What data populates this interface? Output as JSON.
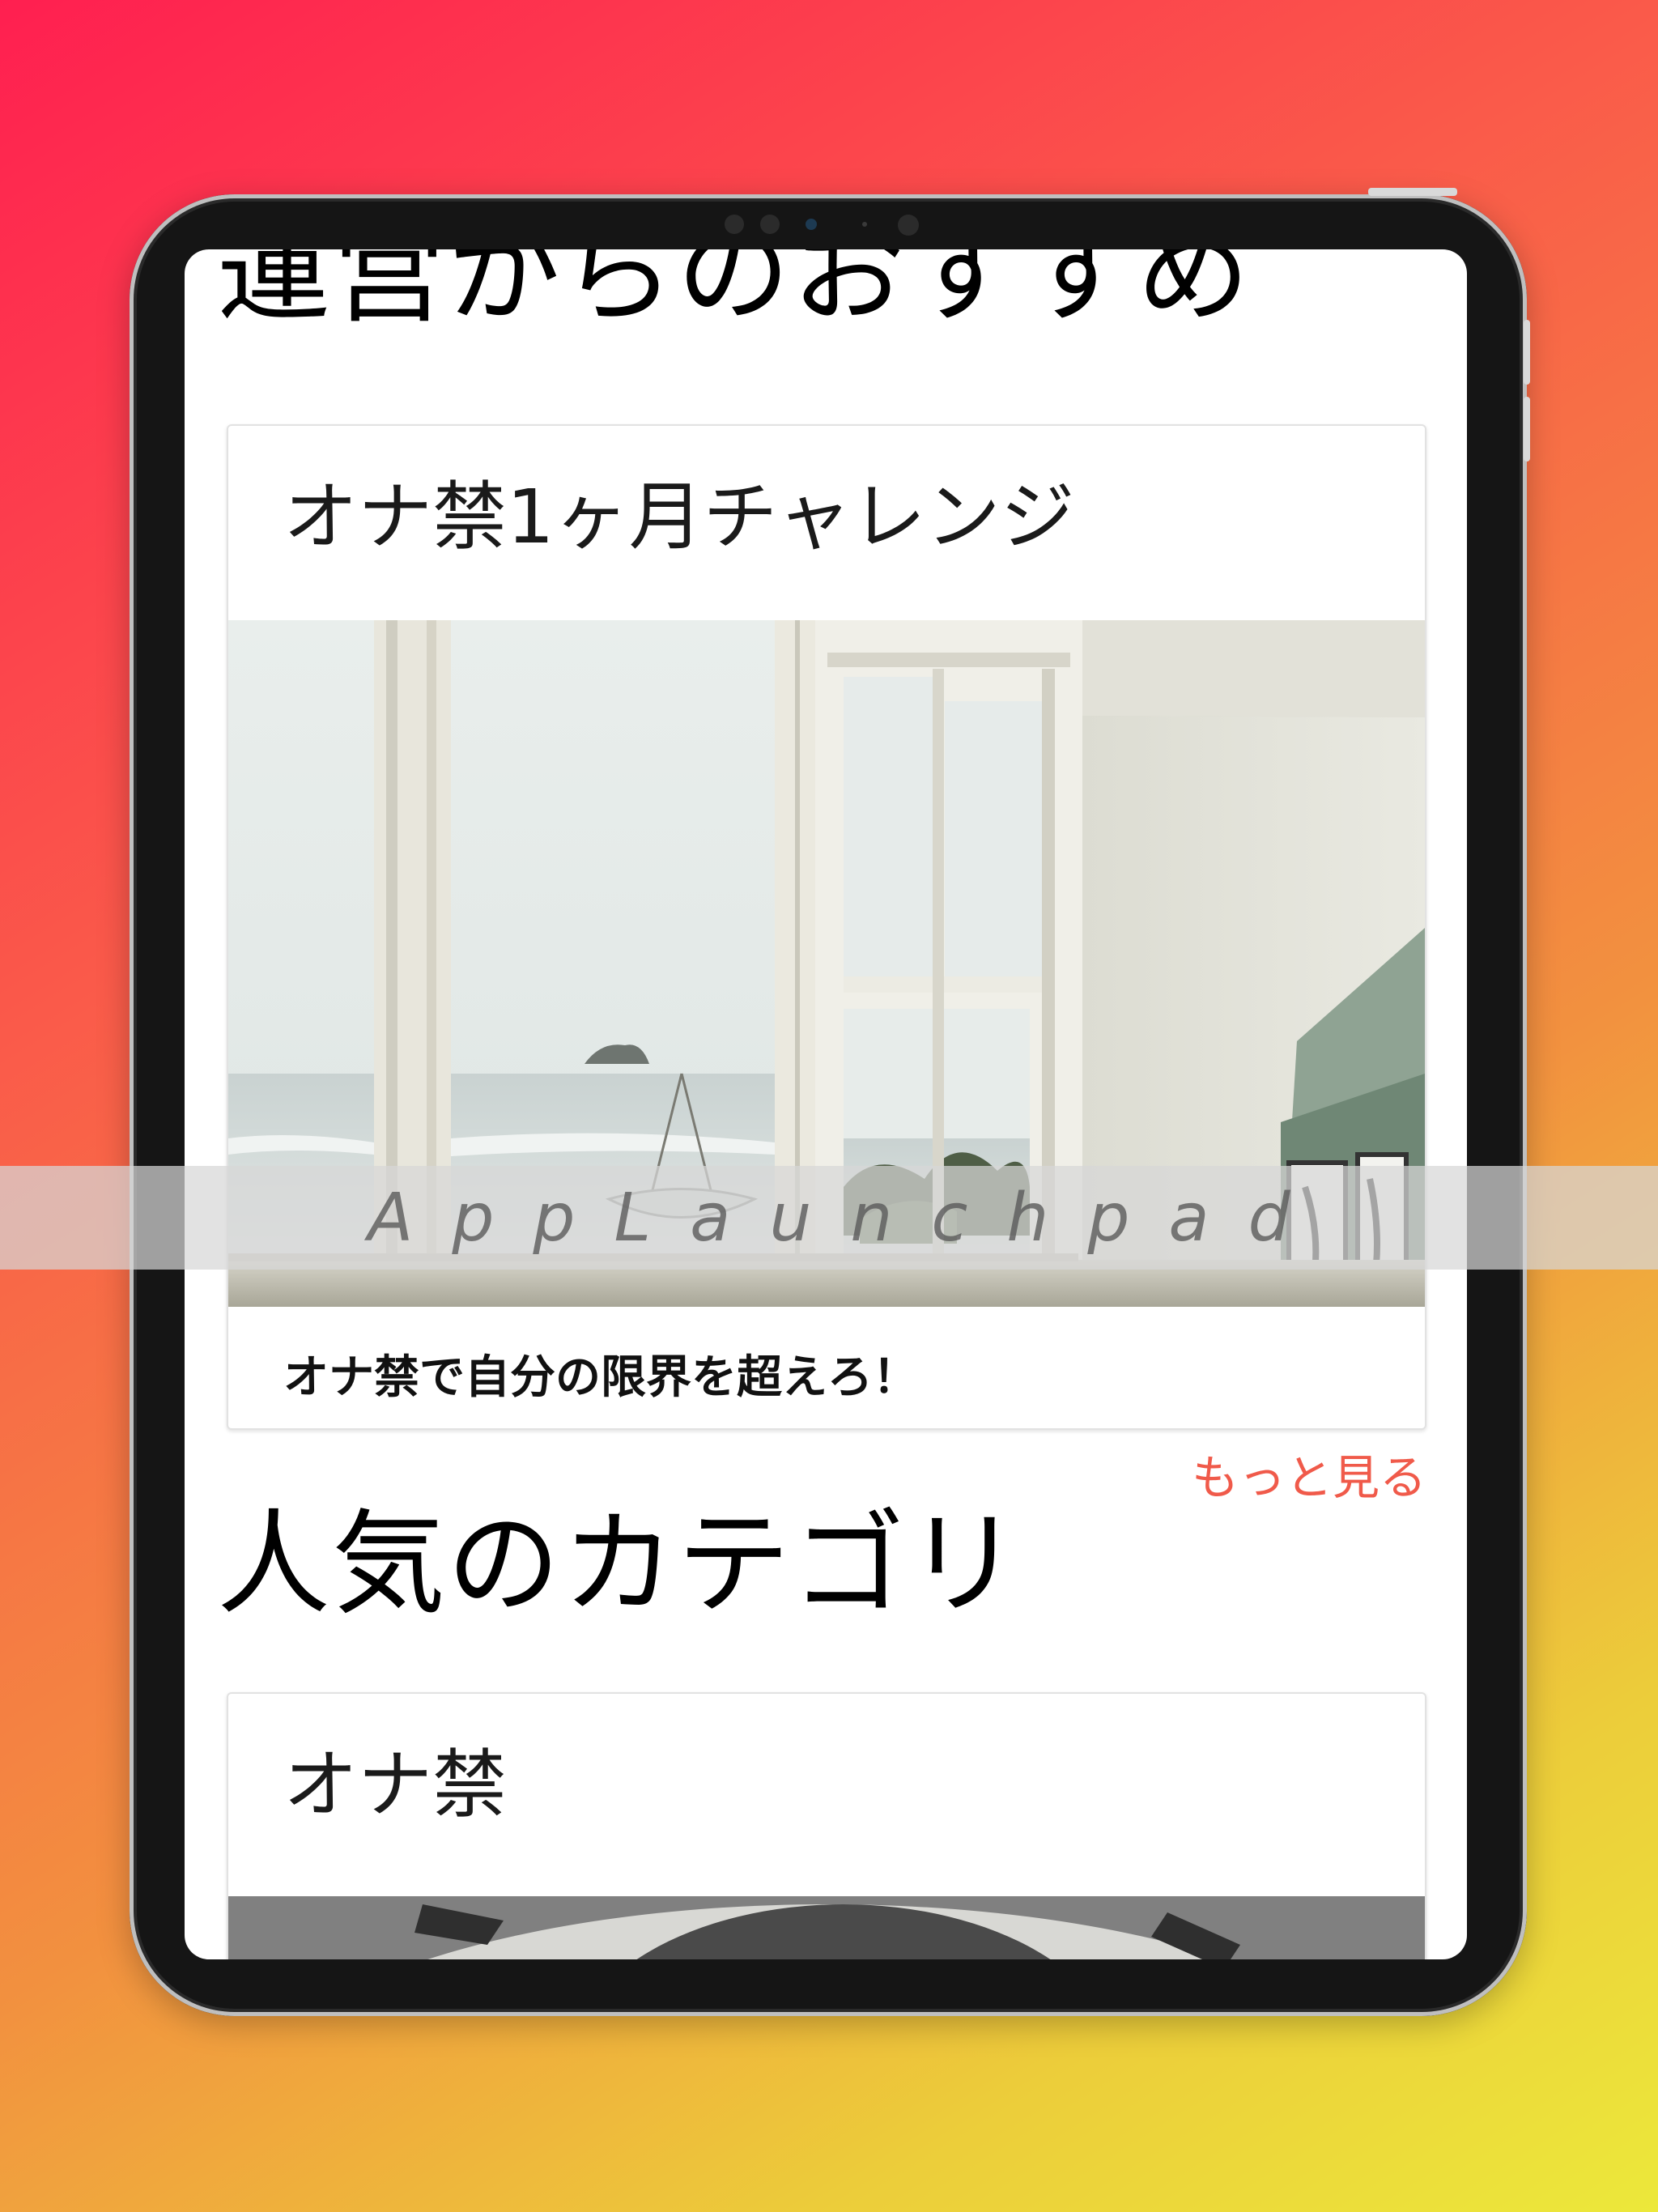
{
  "sections": {
    "recommend_title": "運営からのおすすめ",
    "popular_title": "人気のカテゴリ"
  },
  "recommend_card": {
    "title": "オナ禁1ヶ月チャレンジ",
    "description": "オナ禁で自分の限界を超えろ！",
    "image": "window-ocean-view-photo"
  },
  "more_link": "もっと見る",
  "category_card": {
    "title": "オナ禁",
    "image": "category-photo"
  },
  "watermark": "AppLaunchpad",
  "colors": {
    "accent": "#f05a4a",
    "gradient_start": "#ff1f50",
    "gradient_end": "#ece83a"
  }
}
